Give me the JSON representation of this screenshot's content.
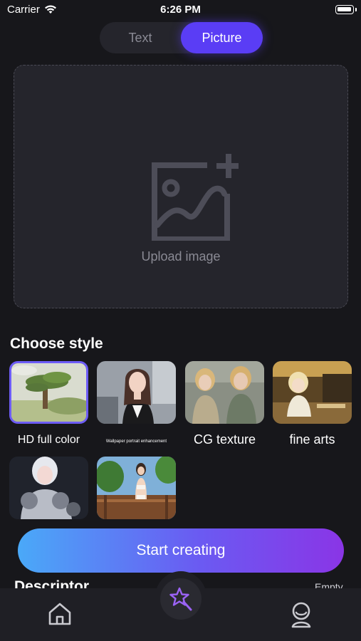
{
  "status_bar": {
    "carrier": "Carrier",
    "time": "6:26 PM"
  },
  "mode_tabs": [
    {
      "label": "Text",
      "selected": false
    },
    {
      "label": "Picture",
      "selected": true
    }
  ],
  "upload": {
    "label": "Upload image",
    "icon": "image-add-icon"
  },
  "choose_style": {
    "title": "Choose style",
    "styles": [
      {
        "label": "HD full color",
        "selected": true
      },
      {
        "label": "Wallpaper portrait enhancement",
        "selected": false
      },
      {
        "label": "CG texture",
        "selected": false
      },
      {
        "label": "fine arts",
        "selected": false
      },
      {
        "label": "",
        "selected": false
      },
      {
        "label": "",
        "selected": false
      }
    ]
  },
  "start_button": {
    "label": "Start creating"
  },
  "descriptor": {
    "title": "Descriptor",
    "value": "Empty"
  },
  "tab_bar": {
    "items": [
      "home-icon",
      "magic-wand-icon",
      "profile-icon"
    ]
  },
  "colors": {
    "accent": "#5a3df5",
    "gradient_start": "#4aa9f8",
    "gradient_end": "#8a35e6",
    "background": "#17171b",
    "card": "#25252c"
  }
}
